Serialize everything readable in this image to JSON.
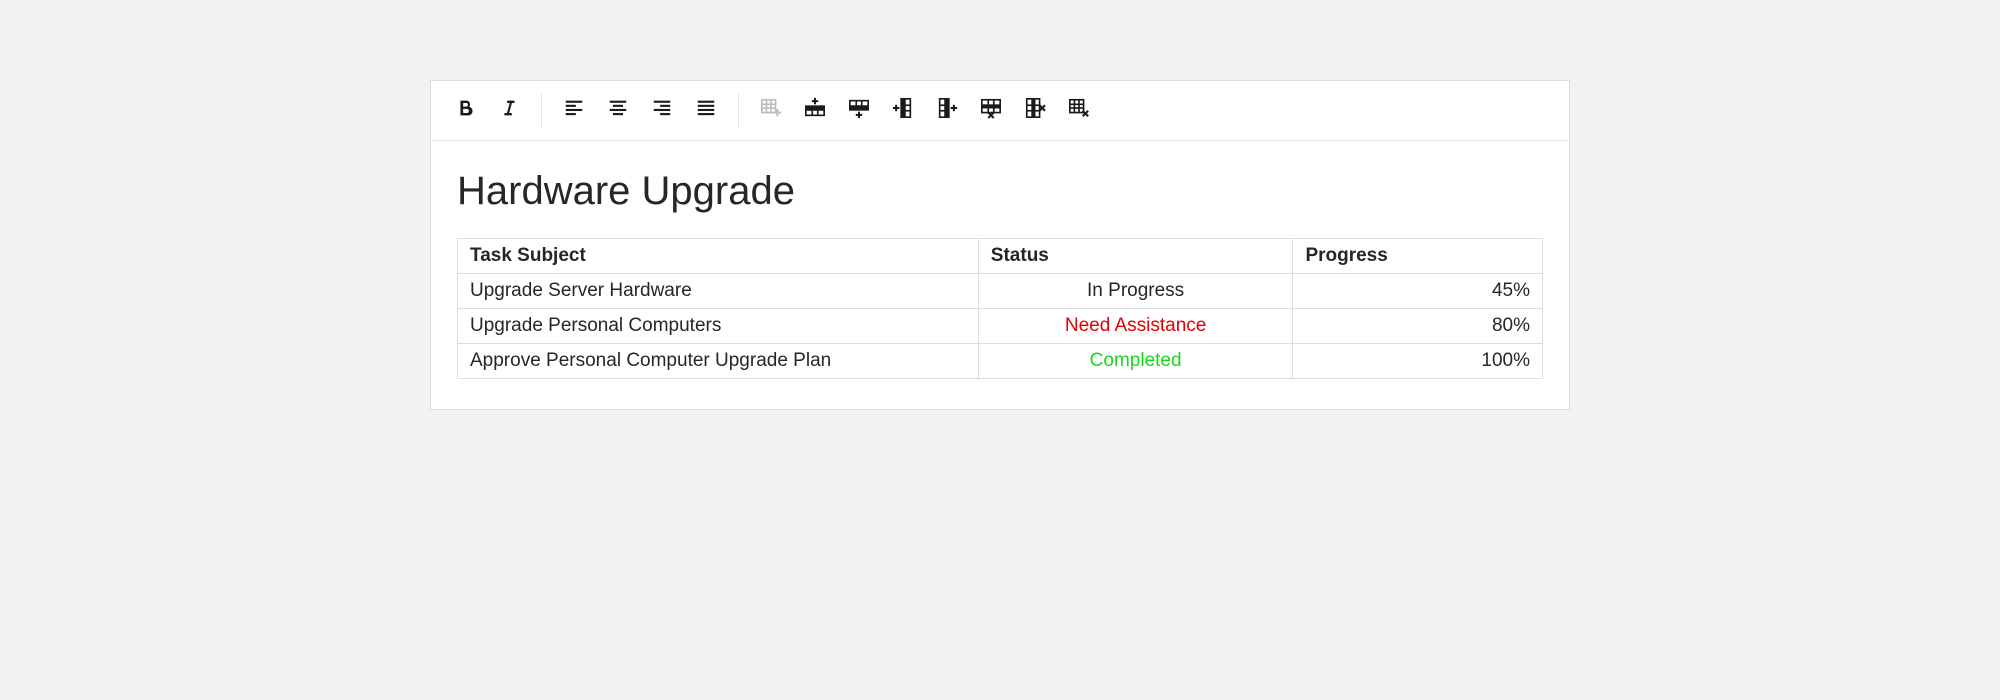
{
  "title": "Hardware Upgrade",
  "toolbar": {
    "bold_icon": "bold",
    "italic_icon": "italic",
    "align_left_icon": "align-left",
    "align_center_icon": "align-center",
    "align_right_icon": "align-right",
    "align_justify_icon": "align-justify",
    "insert_table_icon": "insert-table",
    "insert_row_above_icon": "insert-row-above",
    "insert_row_below_icon": "insert-row-below",
    "insert_col_left_icon": "insert-column-left",
    "insert_col_right_icon": "insert-column-right",
    "delete_row_icon": "delete-row",
    "delete_col_icon": "delete-column",
    "delete_table_icon": "delete-table"
  },
  "table": {
    "headers": {
      "subject": "Task Subject",
      "status": "Status",
      "progress": "Progress"
    },
    "rows": [
      {
        "subject": "Upgrade Server Hardware",
        "status": "In Progress",
        "status_color": "default",
        "progress": "45%"
      },
      {
        "subject": "Upgrade Personal Computers",
        "status": "Need Assistance",
        "status_color": "red",
        "progress": "80%"
      },
      {
        "subject": "Approve Personal Computer Upgrade Plan",
        "status": "Completed",
        "status_color": "green",
        "progress": "100%"
      }
    ]
  }
}
